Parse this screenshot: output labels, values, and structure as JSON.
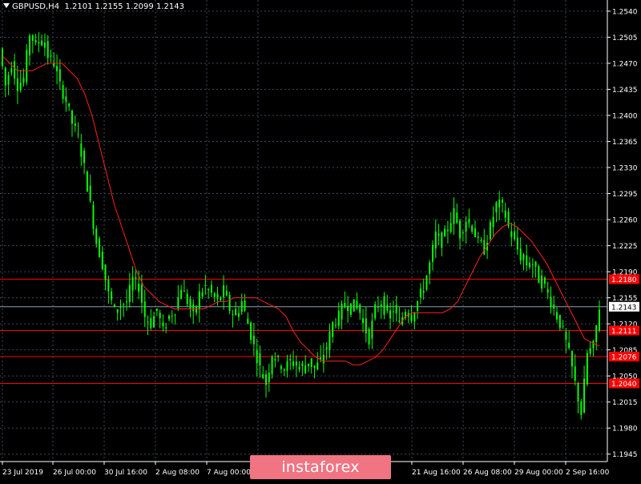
{
  "header": {
    "symbol": "GBPUSD,H4",
    "ohlc": "1.2101 1.2155 1.2099 1.2143"
  },
  "watermark": {
    "text": "instaforex"
  },
  "colors": {
    "background": "#000000",
    "candle": "#00ff00",
    "moving_average": "#ff2020",
    "level_line": "#ff0000",
    "level_label_bg": "#ff0000",
    "current_price_line": "#8aa0b4",
    "grid": "#3a4a5a",
    "axis": "#ffffff",
    "watermark_bg": "#f07482"
  },
  "chart_data": {
    "type": "line",
    "chart_style": "candlestick",
    "symbol": "GBPUSD",
    "timeframe": "H4",
    "ylim": [
      1.1935,
      1.2555
    ],
    "y_ticks": [
      "1.2540",
      "1.2505",
      "1.2470",
      "1.2435",
      "1.2400",
      "1.2365",
      "1.2330",
      "1.2295",
      "1.2260",
      "1.2225",
      "1.2190",
      "1.2155",
      "1.2120",
      "1.2085",
      "1.2050",
      "1.2015",
      "1.1980",
      "1.1945"
    ],
    "x_ticks": [
      "23 Jul 2019",
      "26 Jul 00:00",
      "30 Jul 16:00",
      "2 Aug 08:00",
      "7 Aug 00:00",
      "",
      "21 Aug 16:00",
      "26 Aug 08:00",
      "29 Aug 00:00",
      "2 Sep 16:00"
    ],
    "grid": true,
    "levels": [
      {
        "value": 1.218,
        "label": "1.2180"
      },
      {
        "value": 1.2111,
        "label": "1.2111"
      },
      {
        "value": 1.2076,
        "label": "1.2076"
      },
      {
        "value": 1.204,
        "label": "1.2040"
      }
    ],
    "current_price": {
      "value": 1.2143,
      "label": "1.2143"
    },
    "series": [
      {
        "values": [
          1.249,
          1.244,
          1.247,
          1.244,
          1.245,
          1.251,
          1.2495,
          1.2505,
          1.248,
          1.247,
          1.244,
          1.242,
          1.239,
          1.237,
          1.233,
          1.228,
          1.223,
          1.22,
          1.216,
          1.214,
          1.2145,
          1.215,
          1.218,
          1.217,
          1.213,
          1.212,
          1.214,
          1.211,
          1.213,
          1.214,
          1.217,
          1.215,
          1.213,
          1.216,
          1.217,
          1.216,
          1.215,
          1.2165,
          1.214,
          1.213,
          1.215,
          1.212,
          1.209,
          1.206,
          1.204,
          1.208,
          1.207,
          1.206,
          1.207,
          1.2065,
          1.206,
          1.207,
          1.206,
          1.207,
          1.209,
          1.212,
          1.213,
          1.215,
          1.214,
          1.215,
          1.212,
          1.21,
          1.214,
          1.215,
          1.213,
          1.214,
          1.212,
          1.214,
          1.213,
          1.215,
          1.217,
          1.22,
          1.224,
          1.223,
          1.225,
          1.227,
          1.224,
          1.226,
          1.225,
          1.223,
          1.222,
          1.225,
          1.228,
          1.228,
          1.225,
          1.223,
          1.221,
          1.22,
          1.22,
          1.218,
          1.217,
          1.215,
          1.213,
          1.211,
          1.208,
          1.204,
          1.2,
          1.208,
          1.209,
          1.2143
        ]
      },
      {
        "name": "",
        "values": [
          1.248,
          1.247,
          1.246,
          1.246,
          1.246,
          1.2465,
          1.247,
          1.247,
          1.247,
          1.246,
          1.245,
          1.243,
          1.24,
          1.236,
          1.232,
          1.228,
          1.225,
          1.222,
          1.219,
          1.217,
          1.216,
          1.215,
          1.2145,
          1.214,
          1.214,
          1.214,
          1.214,
          1.214,
          1.2145,
          1.215,
          1.215,
          1.2155,
          1.2155,
          1.2155,
          1.2155,
          1.215,
          1.2145,
          1.214,
          1.213,
          1.211,
          1.2095,
          1.2085,
          1.2075,
          1.207,
          1.207,
          1.207,
          1.207,
          1.2065,
          1.2065,
          1.207,
          1.2075,
          1.2085,
          1.21,
          1.2115,
          1.213,
          1.2135,
          1.2135,
          1.2135,
          1.2135,
          1.2135,
          1.214,
          1.215,
          1.217,
          1.219,
          1.221,
          1.2225,
          1.224,
          1.225,
          1.2255,
          1.225,
          1.224,
          1.223,
          1.2215,
          1.22,
          1.218,
          1.216,
          1.214,
          1.212,
          1.21,
          1.2095,
          1.209
        ]
      }
    ]
  }
}
